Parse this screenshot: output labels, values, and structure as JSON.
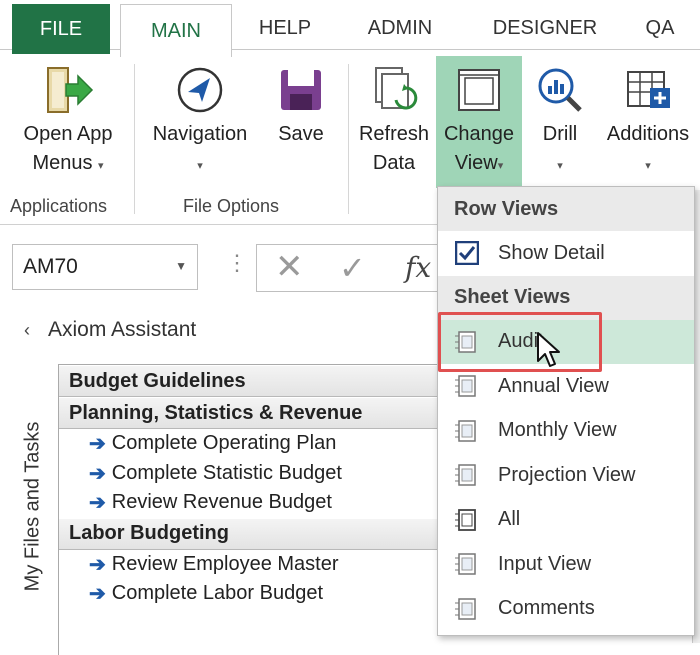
{
  "tabs": [
    {
      "label": "FILE"
    },
    {
      "label": "MAIN"
    },
    {
      "label": "HELP"
    },
    {
      "label": "ADMIN"
    },
    {
      "label": "DESIGNER"
    },
    {
      "label": "QA"
    }
  ],
  "ribbon": {
    "open_app_menus": {
      "line1": "Open App",
      "line2": "Menus"
    },
    "navigation": {
      "label": "Navigation"
    },
    "save": {
      "label": "Save"
    },
    "refresh_data": {
      "line1": "Refresh",
      "line2": "Data"
    },
    "change_view": {
      "line1": "Change",
      "line2": "View"
    },
    "drill": {
      "label": "Drill"
    },
    "additions": {
      "label": "Additions"
    },
    "groups": {
      "applications": "Applications",
      "file_options": "File Options"
    }
  },
  "formula_bar": {
    "name_box": "AM70",
    "fx": "fx"
  },
  "assistant": {
    "title": "Axiom Assistant",
    "side_tab": "My Files and Tasks",
    "sections": [
      {
        "title": "Budget Guidelines",
        "items": []
      },
      {
        "title": "Planning, Statistics & Revenue",
        "items": [
          "Complete Operating Plan",
          "Complete Statistic Budget",
          "Review Revenue Budget"
        ]
      },
      {
        "title": "Labor Budgeting",
        "items": [
          "Review Employee Master",
          "Complete Labor Budget"
        ]
      }
    ]
  },
  "menu": {
    "row_views_header": "Row Views",
    "show_detail": "Show Detail",
    "sheet_views_header": "Sheet Views",
    "items": [
      "Audit",
      "Annual View",
      "Monthly View",
      "Projection View",
      "All",
      "Input View",
      "Comments"
    ]
  },
  "colors": {
    "accent": "#217346",
    "highlight": "#9fd5b7",
    "hover": "#cde8d9",
    "callout": "#e05050"
  }
}
